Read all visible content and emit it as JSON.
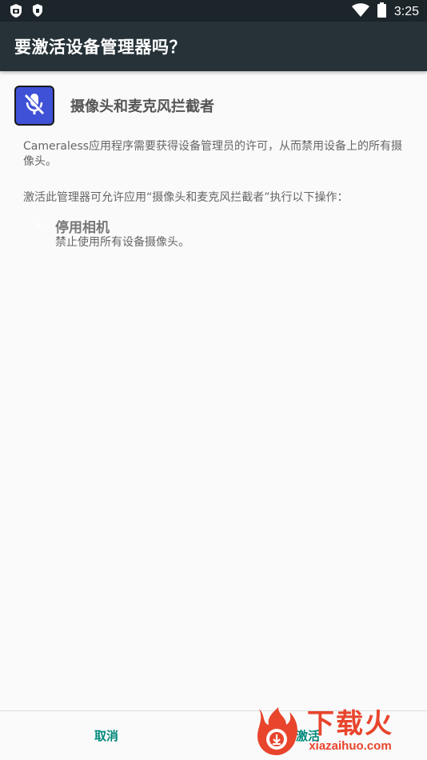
{
  "status_bar": {
    "time": "3:25",
    "left_icons": [
      "camera-shield-icon",
      "shield-icon"
    ],
    "right_icons": [
      "wifi-icon",
      "battery-icon"
    ]
  },
  "app_bar": {
    "title": "要激活设备管理器吗？"
  },
  "admin_app": {
    "icon": "mic-off-icon",
    "icon_color": "#3f51d6",
    "name": "摄像头和麦克风拦截者"
  },
  "description": "Cameraless应用程序需要获得设备管理员的许可，从而禁用设备上的所有摄像头。",
  "permissions_intro": "激活此管理器可允许应用“摄像头和麦克风拦截者”执行以下操作：",
  "policies": [
    {
      "title": "停用相机",
      "description": "禁止使用所有设备摄像头。"
    }
  ],
  "buttons": {
    "cancel": "取消",
    "activate": "激活"
  },
  "watermark": {
    "brand": "下载火",
    "url": "xiazaihuo.com",
    "color": "#e8452c"
  },
  "colors": {
    "status_bar": "#1c252a",
    "app_bar": "#263238",
    "accent": "#00897b",
    "background": "#fafafa"
  }
}
